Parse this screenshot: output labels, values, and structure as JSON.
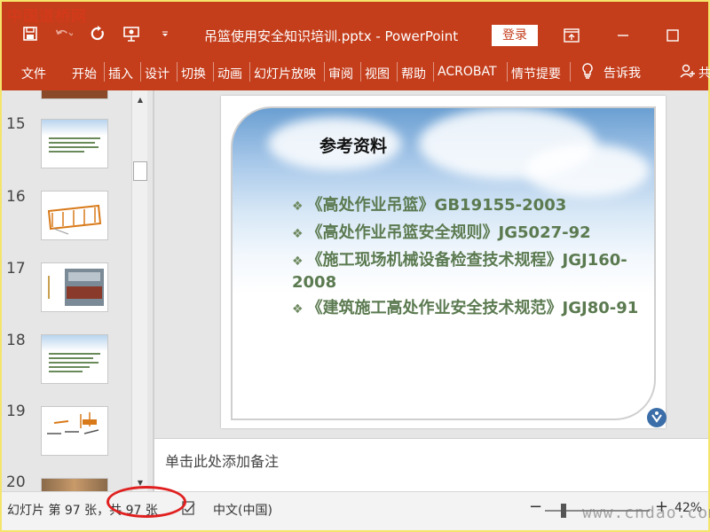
{
  "watermark_tl": "中国道桥网",
  "watermark_br": "www.cndao.com",
  "title": "吊篮使用安全知识培训.pptx  -  PowerPoint",
  "login_label": "登录",
  "ribbon": {
    "tabs": [
      "文件",
      "开始",
      "插入",
      "设计",
      "切换",
      "动画",
      "幻灯片放映",
      "审阅",
      "视图",
      "帮助",
      "ACROBAT",
      "情节提要"
    ],
    "tell_me": "告诉我",
    "share": "共"
  },
  "thumbnails": [
    {
      "num": "15",
      "kind": "text"
    },
    {
      "num": "16",
      "kind": "photo"
    },
    {
      "num": "17",
      "kind": "photo"
    },
    {
      "num": "18",
      "kind": "text"
    },
    {
      "num": "19",
      "kind": "diagram"
    },
    {
      "num": "20",
      "kind": "photo"
    }
  ],
  "slide": {
    "title": "参考资料",
    "references": [
      "《高处作业吊篮》GB19155-2003",
      "《高处作业吊篮安全规则》JG5027-92",
      "《施工现场机械设备检查技术规程》JGJ160-2008",
      "《建筑施工高处作业安全技术规范》JGJ80-91"
    ]
  },
  "notes_placeholder": "单击此处添加备注",
  "status": {
    "slide_info": "幻灯片 第 97 张，共 97 张",
    "language": "中文(中国)",
    "zoom_minus": "−",
    "zoom_plus": "+",
    "zoom_level": "42%"
  },
  "colors": {
    "accent": "#c43e1c",
    "ref_text": "#5b7a50",
    "annotation": "#e02020"
  }
}
